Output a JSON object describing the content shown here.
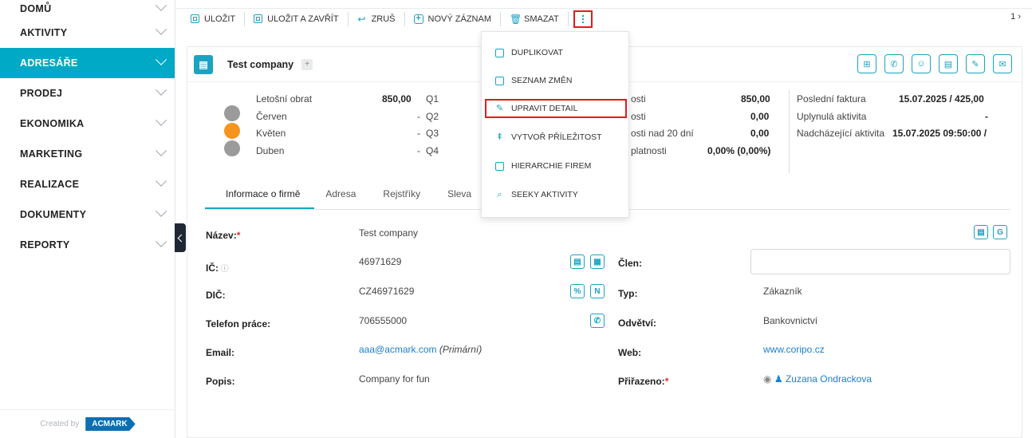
{
  "sidebar": {
    "items": [
      {
        "label": "DOMŮ"
      },
      {
        "label": "AKTIVITY"
      },
      {
        "label": "ADRESÁŘE"
      },
      {
        "label": "PRODEJ"
      },
      {
        "label": "EKONOMIKA"
      },
      {
        "label": "MARKETING"
      },
      {
        "label": "REALIZACE"
      },
      {
        "label": "DOKUMENTY"
      },
      {
        "label": "REPORTY"
      }
    ],
    "active_index": 2,
    "footer_text": "Created by",
    "footer_logo": "ACMARK"
  },
  "toolbar": {
    "save": "ULOŽIT",
    "save_close": "ULOŽIT A ZAVŘÍT",
    "cancel": "ZRUŠ",
    "new_record": "NOVÝ ZÁZNAM",
    "delete": "SMAZAT",
    "pager": "1 ›"
  },
  "dropdown": {
    "items": [
      {
        "label": "DUPLIKOVAT",
        "icon": "copy-icon"
      },
      {
        "label": "SEZNAM ZMĚN",
        "icon": "list-icon"
      },
      {
        "label": "UPRAVIT DETAIL",
        "icon": "pencil-icon"
      },
      {
        "label": "VYTVOŘ PŘÍLEŽITOST",
        "icon": "signpost-icon"
      },
      {
        "label": "HIERARCHIE FIREM",
        "icon": "hierarchy-icon"
      },
      {
        "label": "SEEKY AKTIVITY",
        "icon": "search-icon"
      }
    ],
    "highlighted_index": 2
  },
  "record": {
    "title": "Test company",
    "turnover": {
      "label": "Letošní obrat",
      "value": "850,00",
      "rows": [
        {
          "month": "Červen",
          "value": "-",
          "quarter": "Q1",
          "color": "#9b9b9b"
        },
        {
          "month": "Květen",
          "value": "-",
          "quarter": "Q2",
          "color": "#f7941d"
        },
        {
          "month": "Duben",
          "value": "-",
          "quarter": "Q3",
          "color": "#9b9b9b"
        },
        {
          "month": "",
          "value": "-",
          "quarter": "Q4",
          "color": ""
        }
      ]
    },
    "stats_mid": [
      {
        "label": "osti",
        "value": "850,00"
      },
      {
        "label": "osti",
        "value": "0,00"
      },
      {
        "label": "osti nad 20 dní",
        "value": "0,00"
      },
      {
        "label": "platnosti",
        "value": "0,00% (0,00%)"
      }
    ],
    "stats_right": [
      {
        "label": "Poslední faktura",
        "value": "15.07.2025 / 425,00"
      },
      {
        "label": "Uplynulá aktivita",
        "value": "-"
      },
      {
        "label": "Nadcházející aktivita",
        "value": "15.07.2025 09:50:00 /"
      }
    ]
  },
  "tabs": [
    "Informace o firmě",
    "Adresa",
    "Rejstříky",
    "Sleva"
  ],
  "form": {
    "name_label": "Název:",
    "name_value": "Test company",
    "ic_label": "IČ:",
    "ic_value": "46971629",
    "dic_label": "DIČ:",
    "dic_value": "CZ46971629",
    "phone_label": "Telefon práce:",
    "phone_value": "706555000",
    "email_label": "Email:",
    "email_value": "aaa@acmark.com",
    "email_note": "(Primární)",
    "desc_label": "Popis:",
    "desc_value": "Company for fun",
    "member_label": "Člen:",
    "type_label": "Typ:",
    "type_value": "Zákazník",
    "industry_label": "Odvětví:",
    "industry_value": "Bankovnictví",
    "web_label": "Web:",
    "web_value": "www.coripo.cz",
    "assigned_label": "Přiřazeno:",
    "assigned_value": "Zuzana Ondrackova"
  }
}
